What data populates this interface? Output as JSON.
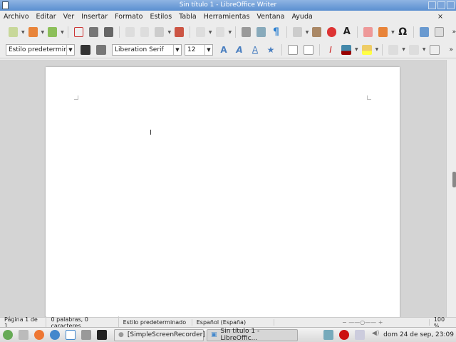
{
  "window": {
    "title": "Sin título 1 - LibreOffice Writer"
  },
  "menu": [
    "Archivo",
    "Editar",
    "Ver",
    "Insertar",
    "Formato",
    "Estilos",
    "Tabla",
    "Herramientas",
    "Ventana",
    "Ayuda"
  ],
  "menu_close": "×",
  "format_toolbar": {
    "paragraph_style": "Estilo predetermin",
    "font_name": "Liberation Serif",
    "font_size": "12",
    "more": "»"
  },
  "standard_toolbar": {
    "more": "»",
    "special_char": "Ω"
  },
  "status": {
    "page": "Página 1 de 1",
    "words": "0 palabras, 0 caracteres",
    "style": "Estilo predeterminado",
    "language": "Español (España)",
    "zoom": "100 %"
  },
  "taskbar": {
    "tasks": [
      "[SimpleScreenRecorder]",
      "Sin título 1 - LibreOffic..."
    ],
    "clock": "dom 24 de sep, 23:09"
  }
}
